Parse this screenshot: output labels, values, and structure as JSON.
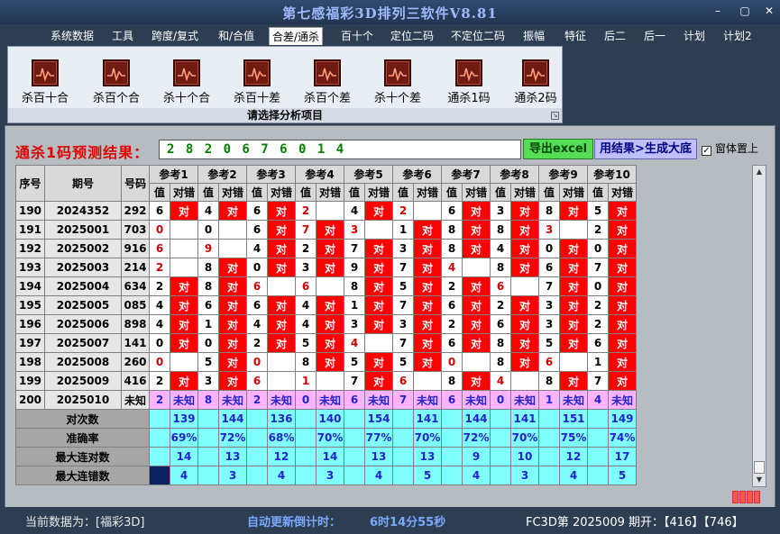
{
  "window": {
    "title": "第七感福彩3D排列三软件V8.81",
    "min_glyph": "–",
    "max_glyph": "▢",
    "close_glyph": "✕"
  },
  "menu": [
    "系统数据",
    "工具",
    "跨度/复式",
    "和/合值",
    "合差/通杀",
    "百十个",
    "定位二码",
    "不定位二码",
    "振幅",
    "特征",
    "后二",
    "后一",
    "计划",
    "计划2"
  ],
  "active_menu": "合差/通杀",
  "ribbon": {
    "buttons": [
      "杀百十合",
      "杀百个合",
      "杀十个合",
      "杀百十差",
      "杀百个差",
      "杀十个差",
      "通杀1码",
      "通杀2码"
    ],
    "footer": "请选择分析项目",
    "icon_name": "chart-icon"
  },
  "prediction": {
    "label": "通杀1码预测结果：",
    "value": "2 8 2 0 6 7 6 0 1 4",
    "excel_button": "导出excel",
    "generate_button": "用结果>生成大底",
    "topmost_label": "窗体置上",
    "topmost_checked": "✓"
  },
  "table": {
    "col_seq": "序号",
    "col_period": "期号",
    "col_number": "号码",
    "refs": [
      "参考1",
      "参考2",
      "参考3",
      "参考4",
      "参考5",
      "参考6",
      "参考7",
      "参考8",
      "参考9",
      "参考10"
    ],
    "sub_value": "值",
    "sub_result": "对错",
    "hit_text": "对",
    "rows": [
      {
        "seq": "190",
        "period": "2024352",
        "num": "292",
        "vals": [
          "6",
          "4",
          "6",
          "2",
          "4",
          "2",
          "6",
          "3",
          "8",
          "5"
        ],
        "hits": [
          1,
          1,
          1,
          0,
          1,
          0,
          1,
          1,
          1,
          1
        ],
        "red": [
          0,
          0,
          0,
          1,
          0,
          1,
          0,
          0,
          0,
          0
        ]
      },
      {
        "seq": "191",
        "period": "2025001",
        "num": "703",
        "vals": [
          "0",
          "0",
          "6",
          "7",
          "3",
          "1",
          "8",
          "8",
          "3",
          "2"
        ],
        "hits": [
          0,
          0,
          1,
          1,
          0,
          1,
          1,
          1,
          0,
          1
        ],
        "red": [
          1,
          0,
          0,
          1,
          1,
          0,
          0,
          0,
          1,
          0
        ]
      },
      {
        "seq": "192",
        "period": "2025002",
        "num": "916",
        "vals": [
          "6",
          "9",
          "4",
          "2",
          "7",
          "3",
          "8",
          "4",
          "0",
          "0"
        ],
        "hits": [
          0,
          0,
          1,
          1,
          1,
          1,
          1,
          1,
          1,
          1
        ],
        "red": [
          1,
          1,
          0,
          0,
          0,
          0,
          0,
          0,
          0,
          0
        ]
      },
      {
        "seq": "193",
        "period": "2025003",
        "num": "214",
        "vals": [
          "2",
          "8",
          "0",
          "3",
          "9",
          "7",
          "4",
          "8",
          "6",
          "7"
        ],
        "hits": [
          0,
          1,
          1,
          1,
          1,
          1,
          0,
          1,
          1,
          1
        ],
        "red": [
          1,
          0,
          0,
          0,
          0,
          0,
          1,
          0,
          0,
          0
        ]
      },
      {
        "seq": "194",
        "period": "2025004",
        "num": "634",
        "vals": [
          "2",
          "8",
          "6",
          "6",
          "8",
          "5",
          "2",
          "6",
          "7",
          "0"
        ],
        "hits": [
          1,
          1,
          0,
          0,
          1,
          1,
          1,
          0,
          1,
          1
        ],
        "red": [
          0,
          0,
          1,
          1,
          0,
          0,
          0,
          1,
          0,
          0
        ]
      },
      {
        "seq": "195",
        "period": "2025005",
        "num": "085",
        "vals": [
          "4",
          "6",
          "6",
          "4",
          "1",
          "7",
          "6",
          "2",
          "3",
          "2"
        ],
        "hits": [
          1,
          1,
          1,
          1,
          1,
          1,
          1,
          1,
          1,
          1
        ],
        "red": [
          0,
          0,
          0,
          0,
          0,
          0,
          0,
          0,
          0,
          0
        ]
      },
      {
        "seq": "196",
        "period": "2025006",
        "num": "898",
        "vals": [
          "4",
          "1",
          "4",
          "4",
          "3",
          "3",
          "2",
          "6",
          "3",
          "2"
        ],
        "hits": [
          1,
          1,
          1,
          1,
          1,
          1,
          1,
          1,
          1,
          1
        ],
        "red": [
          0,
          0,
          0,
          0,
          0,
          0,
          0,
          0,
          0,
          0
        ]
      },
      {
        "seq": "197",
        "period": "2025007",
        "num": "141",
        "vals": [
          "0",
          "0",
          "2",
          "5",
          "4",
          "7",
          "6",
          "8",
          "5",
          "6"
        ],
        "hits": [
          1,
          1,
          1,
          1,
          0,
          1,
          1,
          1,
          1,
          1
        ],
        "red": [
          0,
          0,
          0,
          0,
          1,
          0,
          0,
          0,
          0,
          0
        ]
      },
      {
        "seq": "198",
        "period": "2025008",
        "num": "260",
        "vals": [
          "0",
          "5",
          "0",
          "8",
          "5",
          "5",
          "0",
          "8",
          "6",
          "1"
        ],
        "hits": [
          0,
          1,
          0,
          1,
          1,
          1,
          0,
          1,
          0,
          1
        ],
        "red": [
          1,
          0,
          1,
          0,
          0,
          0,
          1,
          0,
          1,
          0
        ]
      },
      {
        "seq": "199",
        "period": "2025009",
        "num": "416",
        "vals": [
          "2",
          "3",
          "6",
          "1",
          "7",
          "6",
          "8",
          "4",
          "8",
          "7"
        ],
        "hits": [
          1,
          1,
          0,
          0,
          1,
          0,
          1,
          0,
          1,
          1
        ],
        "red": [
          0,
          0,
          1,
          1,
          0,
          1,
          0,
          1,
          0,
          0
        ]
      }
    ],
    "future": {
      "seq": "200",
      "period": "2025010",
      "num": "未知",
      "vals": [
        "2",
        "8",
        "2",
        "0",
        "6",
        "7",
        "6",
        "0",
        "1",
        "4"
      ],
      "result": "未知"
    },
    "stats": [
      {
        "label": "对次数",
        "values": [
          "139",
          "144",
          "136",
          "140",
          "154",
          "141",
          "144",
          "141",
          "151",
          "149"
        ]
      },
      {
        "label": "准确率",
        "values": [
          "69%",
          "72%",
          "68%",
          "70%",
          "77%",
          "70%",
          "72%",
          "70%",
          "75%",
          "74%"
        ]
      },
      {
        "label": "最大连对数",
        "values": [
          "14",
          "13",
          "12",
          "14",
          "13",
          "13",
          "9",
          "10",
          "12",
          "17"
        ]
      },
      {
        "label": "最大连错数",
        "values": [
          "4",
          "3",
          "4",
          "3",
          "4",
          "5",
          "4",
          "3",
          "4",
          "5"
        ]
      }
    ]
  },
  "status": {
    "data_label": "当前数据为：[福彩3D]",
    "countdown_label": "自动更新倒计时：",
    "countdown_value": "6时14分55秒",
    "draw_info": "FC3D第 2025009 期开：【416】【746】"
  },
  "colors": {
    "hit_red": "#ff0000",
    "future_pink": "#ffb3ff",
    "stat_cyan": "#80ffff",
    "title_blue": "#9fb8ff",
    "pred_green": "#008000"
  }
}
